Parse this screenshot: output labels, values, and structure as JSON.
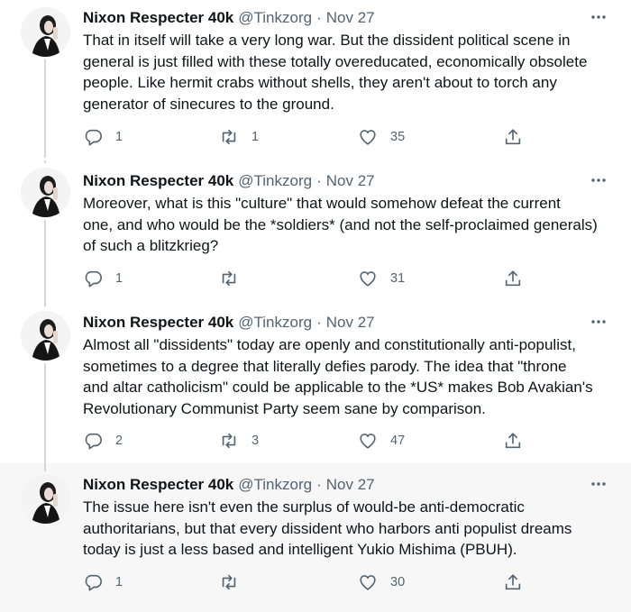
{
  "tweets": [
    {
      "name": "Nixon Respecter 40k",
      "handle": "@Tinkzorg",
      "separator": "·",
      "date": "Nov 27",
      "text": "That in itself will take a very long war. But the dissident political scene in\ngeneral is just filled with these totally overeducated, economically obsolete\npeople. Like hermit crabs without shells, they aren't about to torch any\ngenerator of sinecures to the ground.",
      "replies": "1",
      "retweets": "1",
      "likes": "35"
    },
    {
      "name": "Nixon Respecter 40k",
      "handle": "@Tinkzorg",
      "separator": "·",
      "date": "Nov 27",
      "text": "Moreover, what is this \"culture\" that would somehow defeat the current\none, and who would be the *soldiers* (and not the self-proclaimed generals)\nof such a blitzkrieg?",
      "replies": "1",
      "retweets": "",
      "likes": "31"
    },
    {
      "name": "Nixon Respecter 40k",
      "handle": "@Tinkzorg",
      "separator": "·",
      "date": "Nov 27",
      "text": "Almost all \"dissidents\" today are openly and constitutionally anti-populist,\nsometimes to a degree that literally defies parody. The idea that \"throne\nand altar catholicism\" could be applicable to the *US* makes Bob Avakian's\nRevolutionary Communist Party seem sane by comparison.",
      "replies": "2",
      "retweets": "3",
      "likes": "47"
    },
    {
      "name": "Nixon Respecter 40k",
      "handle": "@Tinkzorg",
      "separator": "·",
      "date": "Nov 27",
      "text": "The issue here isn't even the surplus of would-be anti-democratic\nauthoritarians, but that every dissident who harbors anti populist dreams\ntoday is just a less based and intelligent Yukio Mishima (PBUH).",
      "replies": "1",
      "retweets": "",
      "likes": "30"
    }
  ],
  "icons": {
    "more": "more-horizontal-icon",
    "reply": "reply-bubble-icon",
    "retweet": "retweet-arrows-icon",
    "like": "heart-outline-icon",
    "share": "share-upload-icon"
  },
  "colors": {
    "text": "#0f1419",
    "secondary": "#536471",
    "thread_line": "#cfd9de",
    "highlight_bg": "#f7f7f7"
  }
}
